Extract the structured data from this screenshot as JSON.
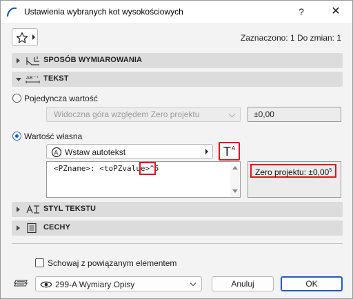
{
  "window": {
    "title": "Ustawienia wybranych kot wysokościowych",
    "help_label": "?",
    "close_label": "✕"
  },
  "toolbar": {
    "favorites_icon": "star-icon",
    "status": "Zaznaczono: 1 Do zmian: 1"
  },
  "sections": {
    "dimensioning": {
      "label": "SPOSÓB WYMIAROWANIA",
      "expanded": false
    },
    "text": {
      "label": "TEKST",
      "expanded": true
    },
    "text_style": {
      "label": "STYL TEKSTU",
      "expanded": false
    },
    "properties": {
      "label": "CECHY",
      "expanded": false
    }
  },
  "text_section": {
    "single_value": {
      "label": "Pojedyncza wartość",
      "selected": false,
      "dropdown_value": "Widoczna góra względem Zero projektu",
      "value": "±0,00"
    },
    "custom_value": {
      "label": "Wartość własna",
      "selected": true,
      "autotext_label": "Wstaw autotekst",
      "superscript_button_main": "T",
      "superscript_button_sup": "A",
      "editor_text": "<PZname>: <toPZvalue>^5",
      "preview_text": "Zero projektu: ±0,00",
      "preview_sup": "5"
    }
  },
  "footer": {
    "hide_with_element_label": "Schowaj z powiązanym elementem",
    "hide_checked": false,
    "layer_value": "299-A Wymiary Opisy",
    "cancel_label": "Anuluj",
    "ok_label": "OK"
  },
  "colors": {
    "highlight": "#e0141e",
    "accent": "#1c5fbf",
    "section_bg": "#dcdcdc",
    "dialog_bg": "#f3f3f3"
  }
}
